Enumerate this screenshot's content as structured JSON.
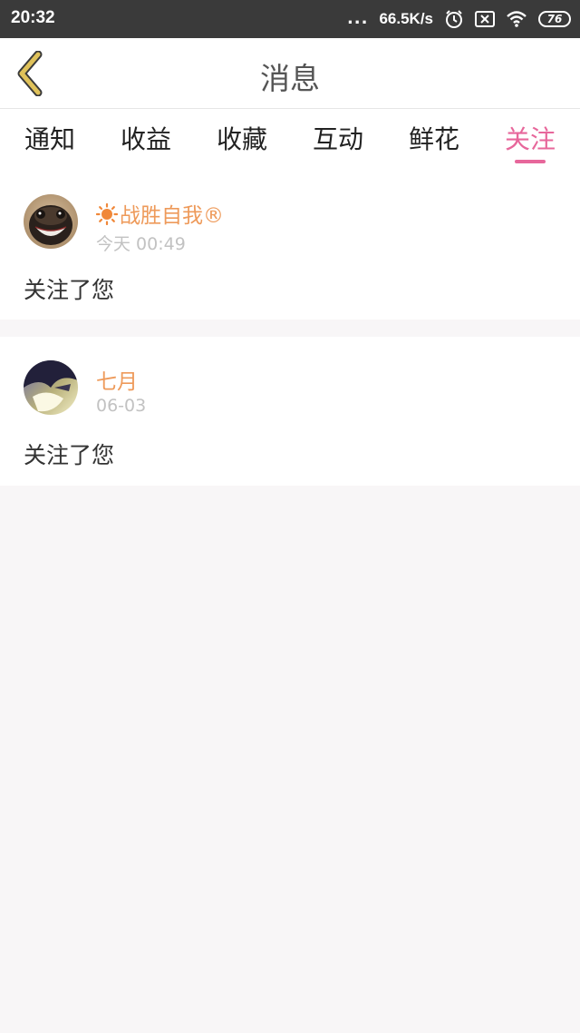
{
  "status_bar": {
    "time": "20:32",
    "dots": "...",
    "network_speed": "66.5K/s",
    "battery_level": "76",
    "icons": [
      "alarm-icon",
      "sim-off-icon",
      "wifi-icon",
      "battery-icon"
    ]
  },
  "header": {
    "title": "消息",
    "back_icon": "chevron-left-icon"
  },
  "tabs": [
    {
      "label": "通知",
      "active": false
    },
    {
      "label": "收益",
      "active": false
    },
    {
      "label": "收藏",
      "active": false
    },
    {
      "label": "互动",
      "active": false
    },
    {
      "label": "鲜花",
      "active": false
    },
    {
      "label": "关注",
      "active": true
    }
  ],
  "notifications": [
    {
      "username": "战胜自我®",
      "prefix_icon": "sun-icon",
      "time": "今天 00:49",
      "message": "关注了您",
      "avatar": "pug-avatar"
    },
    {
      "username": "七月",
      "time": "06-03",
      "message": "关注了您",
      "avatar": "anime-avatar"
    }
  ],
  "colors": {
    "accent": "#e7679b",
    "username": "#ee9a5a",
    "status_bar": "#3a3a3a",
    "background": "#f8f6f7",
    "back_arrow": "#e0c25a"
  }
}
